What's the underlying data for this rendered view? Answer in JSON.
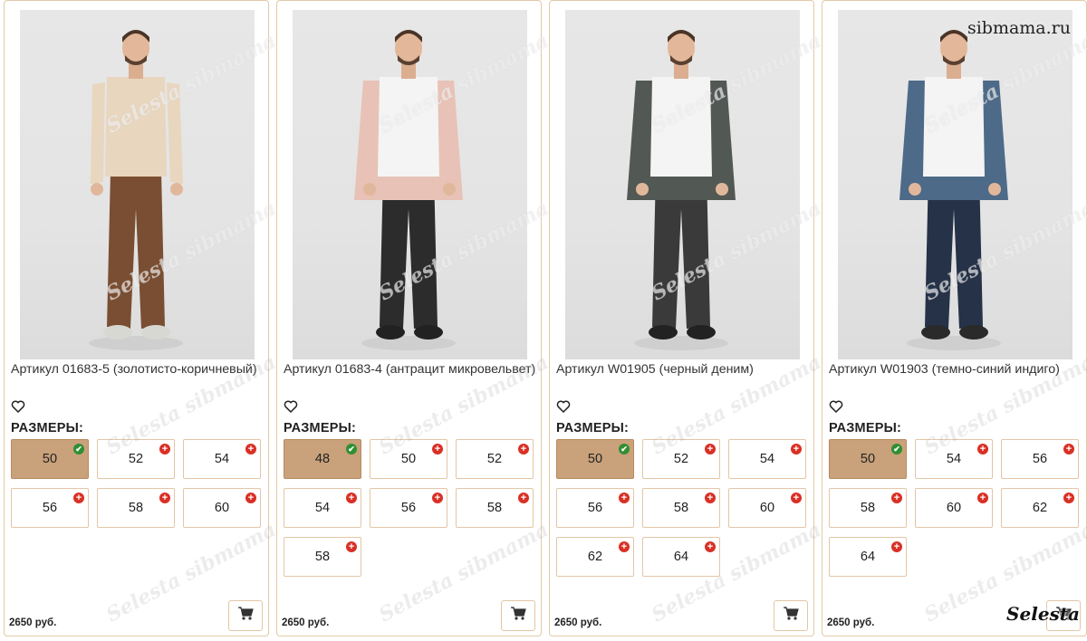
{
  "watermarks": {
    "selesta": "Selesta sibmama.ru",
    "site": "sibmama.ru",
    "corner": "Selesta"
  },
  "sizes_label": "РАЗМЕРЫ:",
  "icons": {
    "favorite": "heart-outline-icon",
    "cart": "shopping-cart-icon",
    "available": "check-icon",
    "add": "plus-icon"
  },
  "colors": {
    "selected_size_bg": "#c9a17a",
    "card_border": "#e3c9a8",
    "add_badge": "#d93025",
    "ok_badge": "#2f8f33"
  },
  "products": [
    {
      "title": "Артикул 01683-5 (золотисто-коричневый)",
      "price": "2650 руб.",
      "photo": {
        "shirt": "#e8d6bf",
        "pants": "#7a4e32",
        "shoes": "#d8d8d2",
        "overshirt": null
      },
      "sizes": [
        {
          "label": "50",
          "selected": true
        },
        {
          "label": "52",
          "selected": false
        },
        {
          "label": "54",
          "selected": false
        },
        {
          "label": "56",
          "selected": false
        },
        {
          "label": "58",
          "selected": false
        },
        {
          "label": "60",
          "selected": false
        }
      ]
    },
    {
      "title": "Артикул 01683-4 (антрацит микровельвет)",
      "price": "2650 руб.",
      "photo": {
        "shirt": "#f4f4f4",
        "pants": "#2c2c2c",
        "shoes": "#222222",
        "overshirt": "#e8c2b6"
      },
      "sizes": [
        {
          "label": "48",
          "selected": true
        },
        {
          "label": "50",
          "selected": false
        },
        {
          "label": "52",
          "selected": false
        },
        {
          "label": "54",
          "selected": false
        },
        {
          "label": "56",
          "selected": false
        },
        {
          "label": "58",
          "selected": false
        },
        {
          "label": "58",
          "selected": false
        }
      ]
    },
    {
      "title": "Артикул W01905 (черный деним)",
      "price": "2650 руб.",
      "photo": {
        "shirt": "#f4f4f4",
        "pants": "#3a3a3a",
        "shoes": "#222222",
        "overshirt": "#525854"
      },
      "sizes": [
        {
          "label": "50",
          "selected": true
        },
        {
          "label": "52",
          "selected": false
        },
        {
          "label": "54",
          "selected": false
        },
        {
          "label": "56",
          "selected": false
        },
        {
          "label": "58",
          "selected": false
        },
        {
          "label": "60",
          "selected": false
        },
        {
          "label": "62",
          "selected": false
        },
        {
          "label": "64",
          "selected": false
        }
      ]
    },
    {
      "title": "Артикул W01903 (темно-синий индиго)",
      "price": "2650 руб.",
      "photo": {
        "shirt": "#f4f4f4",
        "pants": "#253247",
        "shoes": "#2a2a2a",
        "overshirt": "#4d6a88"
      },
      "sizes": [
        {
          "label": "50",
          "selected": true
        },
        {
          "label": "54",
          "selected": false
        },
        {
          "label": "56",
          "selected": false
        },
        {
          "label": "58",
          "selected": false
        },
        {
          "label": "60",
          "selected": false
        },
        {
          "label": "62",
          "selected": false
        },
        {
          "label": "64",
          "selected": false
        }
      ]
    }
  ]
}
